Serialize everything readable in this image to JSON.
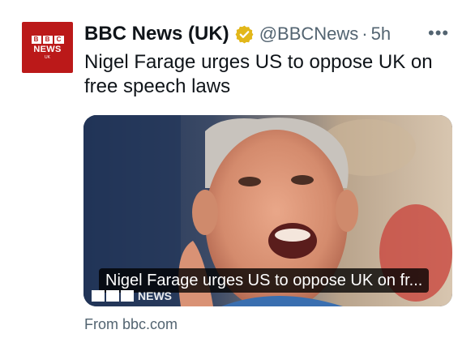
{
  "account": {
    "avatar_top": "BBC",
    "avatar_letters": [
      "B",
      "B",
      "C"
    ],
    "avatar_middle": "NEWS",
    "avatar_bottom": "UK",
    "name": "BBC News (UK)",
    "verified_icon": "verified-badge-gold",
    "handle": "@BBCNews",
    "separator": "·",
    "time": "5h"
  },
  "more_icon": "•••",
  "post_text": "Nigel Farage urges US to oppose UK on free speech laws",
  "card": {
    "title": "Nigel Farage urges US to oppose UK on fr...",
    "logo_text": "NEWS",
    "source": "From bbc.com"
  },
  "colors": {
    "brand_red": "#bb1919",
    "verified_gold": "#e2b719",
    "secondary_text": "#536471"
  }
}
